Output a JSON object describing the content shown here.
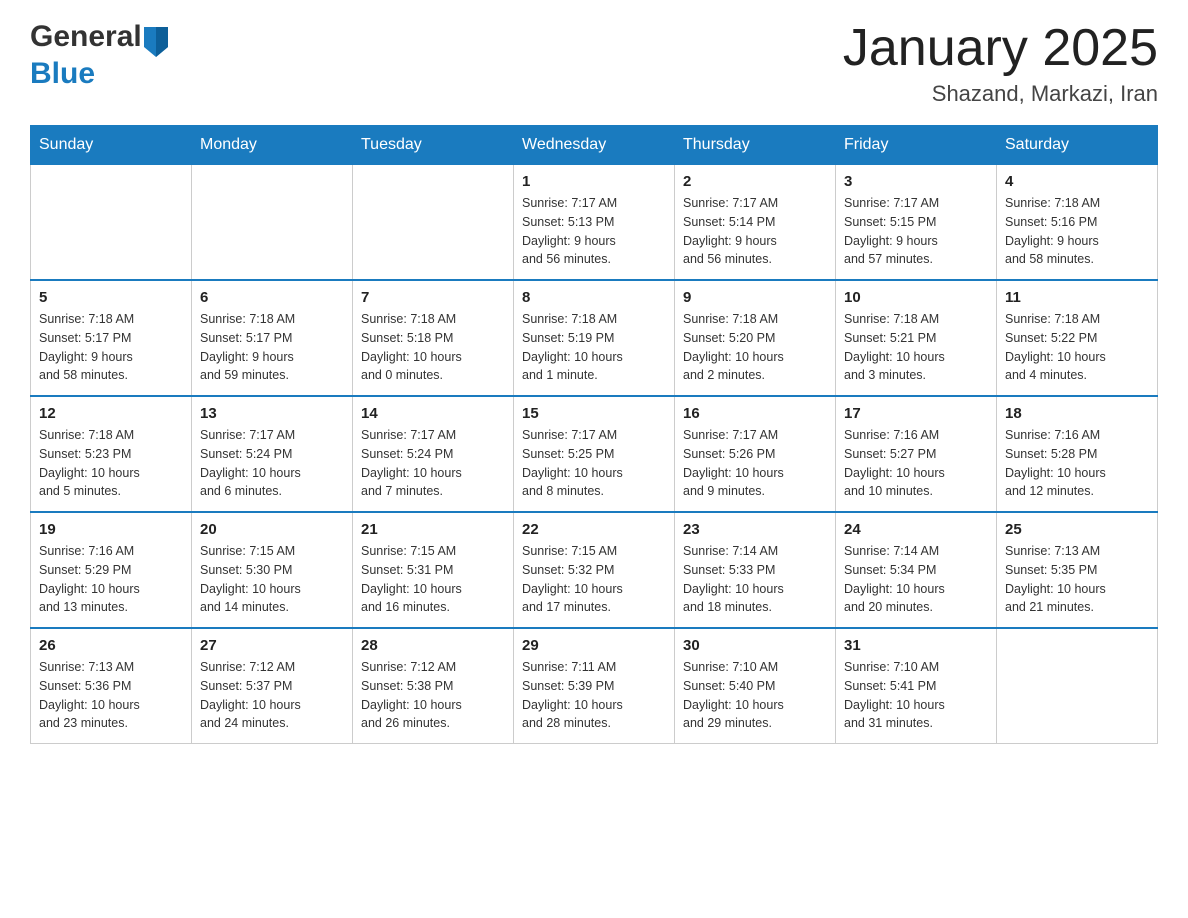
{
  "header": {
    "logo_general": "General",
    "logo_blue": "Blue",
    "title": "January 2025",
    "subtitle": "Shazand, Markazi, Iran"
  },
  "days_of_week": [
    "Sunday",
    "Monday",
    "Tuesday",
    "Wednesday",
    "Thursday",
    "Friday",
    "Saturday"
  ],
  "weeks": [
    [
      {
        "day": "",
        "info": ""
      },
      {
        "day": "",
        "info": ""
      },
      {
        "day": "",
        "info": ""
      },
      {
        "day": "1",
        "info": "Sunrise: 7:17 AM\nSunset: 5:13 PM\nDaylight: 9 hours\nand 56 minutes."
      },
      {
        "day": "2",
        "info": "Sunrise: 7:17 AM\nSunset: 5:14 PM\nDaylight: 9 hours\nand 56 minutes."
      },
      {
        "day": "3",
        "info": "Sunrise: 7:17 AM\nSunset: 5:15 PM\nDaylight: 9 hours\nand 57 minutes."
      },
      {
        "day": "4",
        "info": "Sunrise: 7:18 AM\nSunset: 5:16 PM\nDaylight: 9 hours\nand 58 minutes."
      }
    ],
    [
      {
        "day": "5",
        "info": "Sunrise: 7:18 AM\nSunset: 5:17 PM\nDaylight: 9 hours\nand 58 minutes."
      },
      {
        "day": "6",
        "info": "Sunrise: 7:18 AM\nSunset: 5:17 PM\nDaylight: 9 hours\nand 59 minutes."
      },
      {
        "day": "7",
        "info": "Sunrise: 7:18 AM\nSunset: 5:18 PM\nDaylight: 10 hours\nand 0 minutes."
      },
      {
        "day": "8",
        "info": "Sunrise: 7:18 AM\nSunset: 5:19 PM\nDaylight: 10 hours\nand 1 minute."
      },
      {
        "day": "9",
        "info": "Sunrise: 7:18 AM\nSunset: 5:20 PM\nDaylight: 10 hours\nand 2 minutes."
      },
      {
        "day": "10",
        "info": "Sunrise: 7:18 AM\nSunset: 5:21 PM\nDaylight: 10 hours\nand 3 minutes."
      },
      {
        "day": "11",
        "info": "Sunrise: 7:18 AM\nSunset: 5:22 PM\nDaylight: 10 hours\nand 4 minutes."
      }
    ],
    [
      {
        "day": "12",
        "info": "Sunrise: 7:18 AM\nSunset: 5:23 PM\nDaylight: 10 hours\nand 5 minutes."
      },
      {
        "day": "13",
        "info": "Sunrise: 7:17 AM\nSunset: 5:24 PM\nDaylight: 10 hours\nand 6 minutes."
      },
      {
        "day": "14",
        "info": "Sunrise: 7:17 AM\nSunset: 5:24 PM\nDaylight: 10 hours\nand 7 minutes."
      },
      {
        "day": "15",
        "info": "Sunrise: 7:17 AM\nSunset: 5:25 PM\nDaylight: 10 hours\nand 8 minutes."
      },
      {
        "day": "16",
        "info": "Sunrise: 7:17 AM\nSunset: 5:26 PM\nDaylight: 10 hours\nand 9 minutes."
      },
      {
        "day": "17",
        "info": "Sunrise: 7:16 AM\nSunset: 5:27 PM\nDaylight: 10 hours\nand 10 minutes."
      },
      {
        "day": "18",
        "info": "Sunrise: 7:16 AM\nSunset: 5:28 PM\nDaylight: 10 hours\nand 12 minutes."
      }
    ],
    [
      {
        "day": "19",
        "info": "Sunrise: 7:16 AM\nSunset: 5:29 PM\nDaylight: 10 hours\nand 13 minutes."
      },
      {
        "day": "20",
        "info": "Sunrise: 7:15 AM\nSunset: 5:30 PM\nDaylight: 10 hours\nand 14 minutes."
      },
      {
        "day": "21",
        "info": "Sunrise: 7:15 AM\nSunset: 5:31 PM\nDaylight: 10 hours\nand 16 minutes."
      },
      {
        "day": "22",
        "info": "Sunrise: 7:15 AM\nSunset: 5:32 PM\nDaylight: 10 hours\nand 17 minutes."
      },
      {
        "day": "23",
        "info": "Sunrise: 7:14 AM\nSunset: 5:33 PM\nDaylight: 10 hours\nand 18 minutes."
      },
      {
        "day": "24",
        "info": "Sunrise: 7:14 AM\nSunset: 5:34 PM\nDaylight: 10 hours\nand 20 minutes."
      },
      {
        "day": "25",
        "info": "Sunrise: 7:13 AM\nSunset: 5:35 PM\nDaylight: 10 hours\nand 21 minutes."
      }
    ],
    [
      {
        "day": "26",
        "info": "Sunrise: 7:13 AM\nSunset: 5:36 PM\nDaylight: 10 hours\nand 23 minutes."
      },
      {
        "day": "27",
        "info": "Sunrise: 7:12 AM\nSunset: 5:37 PM\nDaylight: 10 hours\nand 24 minutes."
      },
      {
        "day": "28",
        "info": "Sunrise: 7:12 AM\nSunset: 5:38 PM\nDaylight: 10 hours\nand 26 minutes."
      },
      {
        "day": "29",
        "info": "Sunrise: 7:11 AM\nSunset: 5:39 PM\nDaylight: 10 hours\nand 28 minutes."
      },
      {
        "day": "30",
        "info": "Sunrise: 7:10 AM\nSunset: 5:40 PM\nDaylight: 10 hours\nand 29 minutes."
      },
      {
        "day": "31",
        "info": "Sunrise: 7:10 AM\nSunset: 5:41 PM\nDaylight: 10 hours\nand 31 minutes."
      },
      {
        "day": "",
        "info": ""
      }
    ]
  ]
}
